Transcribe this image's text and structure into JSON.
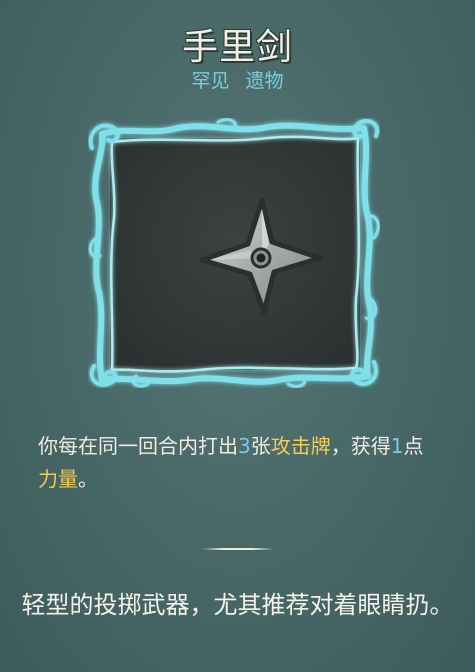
{
  "relic": {
    "name": "手里剑",
    "rarity": "罕见",
    "type": "遗物",
    "description": {
      "part1": "你每在同一回合内打出",
      "count": "3",
      "part2": "张",
      "keyword_attack": "攻击牌",
      "part3": "，获得",
      "amount": "1",
      "part4": "点",
      "keyword_strength": "力量",
      "part5": "。"
    },
    "flavor": "轻型的投掷武器，尤其推荐对着眼睛扔。"
  },
  "colors": {
    "background": "#476666",
    "title_text": "#f3efe2",
    "rarity_text": "#79cde0",
    "number_highlight": "#7dc7ea",
    "keyword_highlight": "#f2cc54",
    "frame_glow": "#7fe0ea"
  },
  "icons": {
    "relic_image": "shuriken-icon"
  }
}
